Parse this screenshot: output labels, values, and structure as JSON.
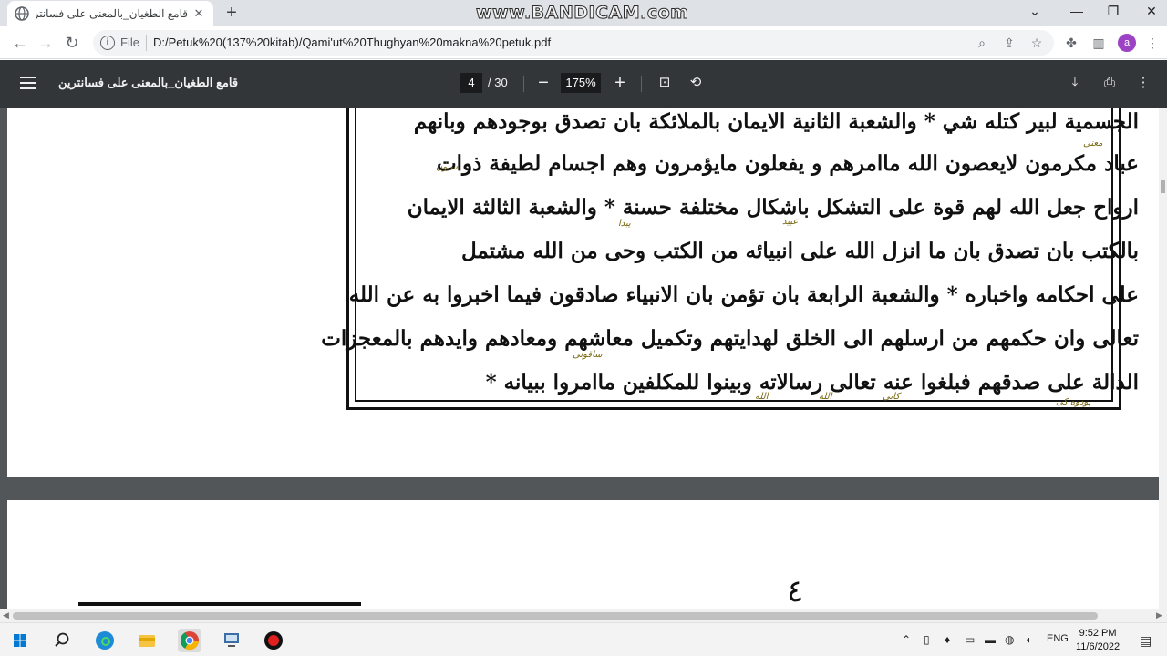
{
  "browser": {
    "tab_title": "قامع الطغيان_بالمعنى على فسانتر",
    "close_glyph": "✕",
    "new_tab_glyph": "+",
    "watermark": "www.BANDICAM.com",
    "scheme_label": "File",
    "url": "D:/Petuk%20(137%20kitab)/Qami'ut%20Thughyan%20makna%20petuk.pdf",
    "avatar_letter": "a"
  },
  "pdf": {
    "title": "قامع الطغيان_بالمعنى على فسانترين",
    "current_page": "4",
    "total_pages": "/ 30",
    "zoom": "175%",
    "scan_lines": [
      "الجسمية لبير كتله شي * والشعبة الثانية الايمان بالملائكة بان تصدق بوجودهم وبانهم",
      "عباد مكرمون لايعصون الله ماامرهم و يفعلون مايؤمرون وهم اجسام لطيفة ذوات",
      "ارواح جعل الله لهم قوة على التشكل باشكال مختلفة حسنة * والشعبة الثالثة الايمان",
      "بالكتب بان تصدق بان ما انزل الله على انبيائه من الكتب وحى من الله مشتمل",
      "على احكامه واخباره * والشعبة الرابعة بان تؤمن بان الانبياء صادقون فيما اخبروا به عن الله",
      "تعالى وان حكمهم من ارسلهم الى الخلق لهدايتهم وتكميل معاشهم ومعادهم وايدهم بالمعجزات",
      "الدالة على صدقهم فبلغوا عنه تعالى رسالاته وبينوا للمكلفين ماامروا ببيانه *"
    ],
    "annotations": [
      "معنى",
      "سيون",
      "عبيد",
      "يبدا",
      "ساقونى",
      "الله",
      "كانى",
      "الله",
      "بودوه كى"
    ],
    "page2_number": "٤"
  },
  "taskbar": {
    "language": "ENG",
    "time": "9:52 PM",
    "date": "11/6/2022"
  },
  "colors": {
    "pdf_toolbar": "#323639",
    "viewer_bg": "#525659",
    "chrome_tabstrip": "#dee1e6",
    "avatar": "#9c42c4",
    "annotation_ink": "#7a6a14"
  }
}
